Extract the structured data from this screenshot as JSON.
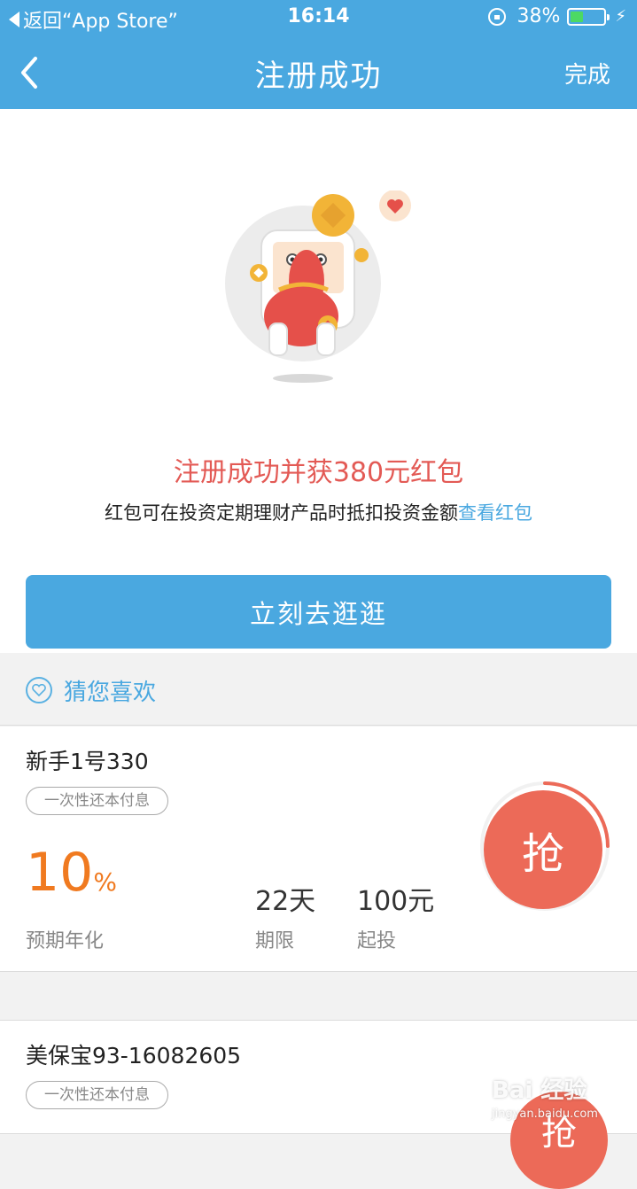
{
  "status_bar": {
    "back_app": "返回“App Store”",
    "time": "16:14",
    "battery": "38%",
    "battery_level": 0.38
  },
  "nav": {
    "title": "注册成功",
    "done": "完成"
  },
  "success": {
    "headline": "注册成功并获380元红包",
    "subtext": "红包可在投资定期理财产品时抵扣投资金额",
    "link": "查看红包"
  },
  "cta": {
    "label": "立刻去逛逛"
  },
  "recommend": {
    "title": "猜您喜欢"
  },
  "products": [
    {
      "name": "新手1号330",
      "tag": "一次性还本付息",
      "rate": "10",
      "rate_unit": "%",
      "rate_label": "预期年化",
      "term": "22天",
      "term_label": "期限",
      "min": "100元",
      "min_label": "起投",
      "action": "抢"
    },
    {
      "name": "美保宝93-16082605",
      "tag": "一次性还本付息",
      "action": "抢"
    }
  ],
  "watermark": {
    "text": "Bai 经验",
    "url": "jingyan.baidu.com"
  },
  "colors": {
    "primary": "#4aa8e0",
    "headline_red": "#e35a55",
    "rate_orange": "#f07a20",
    "grab_red": "#ec6a58"
  }
}
